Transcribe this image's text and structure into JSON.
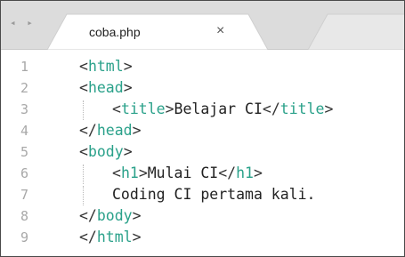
{
  "tabs": {
    "nav_left": "◂",
    "nav_right": "▸",
    "active_tab": "coba.php",
    "close_glyph": "×"
  },
  "colors": {
    "tag": "#2aa18a",
    "text": "#222222",
    "line_numbers": "#a8a8a8",
    "tabbar": "#dcdcdc"
  },
  "lines": [
    {
      "num": "1",
      "indent": 0,
      "open": "<",
      "tag": "html",
      "close": ">",
      "text": ""
    },
    {
      "num": "2",
      "indent": 0,
      "open": "<",
      "tag": "head",
      "close": ">",
      "text": ""
    },
    {
      "num": "3",
      "indent": 1,
      "open": "<",
      "tag": "title",
      "close": ">",
      "text": "Belajar CI",
      "end_open": "</",
      "end_tag": "title",
      "end_close": ">"
    },
    {
      "num": "4",
      "indent": 0,
      "open": "</",
      "tag": "head",
      "close": ">",
      "text": ""
    },
    {
      "num": "5",
      "indent": 0,
      "open": "<",
      "tag": "body",
      "close": ">",
      "text": ""
    },
    {
      "num": "6",
      "indent": 1,
      "open": "<",
      "tag": "h1",
      "close": ">",
      "text": "Mulai CI",
      "end_open": "</",
      "end_tag": "h1",
      "end_close": ">"
    },
    {
      "num": "7",
      "indent": 1,
      "open": "",
      "tag": "",
      "close": "",
      "text": "Coding CI pertama kali."
    },
    {
      "num": "8",
      "indent": 0,
      "open": "</",
      "tag": "body",
      "close": ">",
      "text": ""
    },
    {
      "num": "9",
      "indent": 0,
      "open": "</",
      "tag": "html",
      "close": ">",
      "text": ""
    }
  ]
}
